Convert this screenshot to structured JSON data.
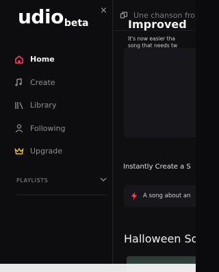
{
  "brand": {
    "name": "udio",
    "badge": "beta"
  },
  "window": {
    "close_glyph": "×"
  },
  "nav": {
    "items": [
      {
        "label": "Home",
        "icon": "home-icon",
        "active": true
      },
      {
        "label": "Create",
        "icon": "music-note-icon",
        "active": false
      },
      {
        "label": "Library",
        "icon": "library-icon",
        "active": false
      },
      {
        "label": "Following",
        "icon": "user-icon",
        "active": false
      },
      {
        "label": "Upgrade",
        "icon": "crown-icon",
        "active": false
      }
    ]
  },
  "playlists": {
    "label": "PLAYLISTS"
  },
  "search": {
    "placeholder": "Une chanson fro"
  },
  "banner": {
    "title": "Improved",
    "subtitle_line1": "It's now easier tha",
    "subtitle_line2": "song that needs tw"
  },
  "instant": {
    "label": "Instantly Create a S"
  },
  "prompt": {
    "text": "A song about an"
  },
  "section": {
    "title": "Halloween So"
  },
  "colors": {
    "accent_red": "#ff3d5a",
    "upgrade_gold": "#f1c232"
  }
}
